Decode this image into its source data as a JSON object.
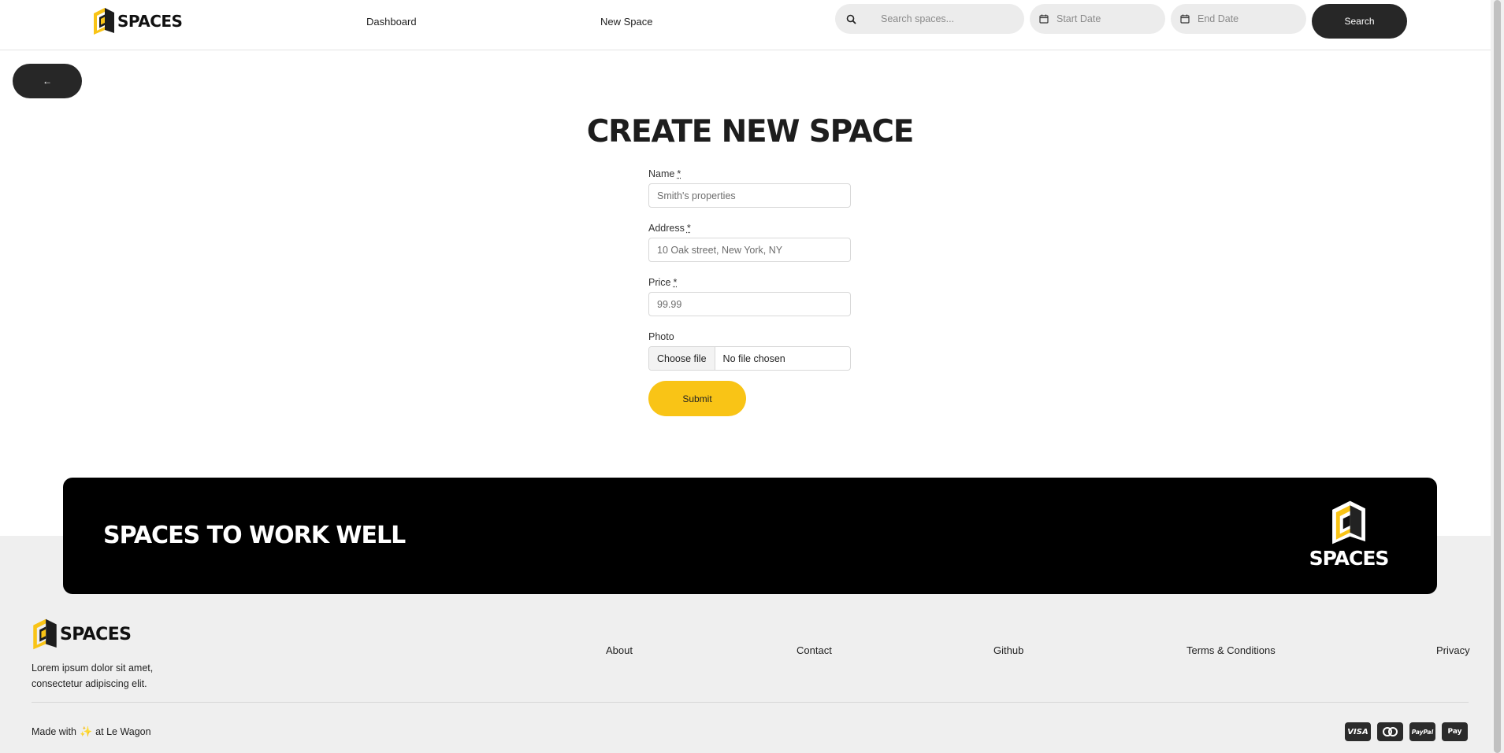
{
  "nav": {
    "brand": "SPACES",
    "links": {
      "dashboard": "Dashboard",
      "new_space": "New Space"
    },
    "search": {
      "placeholder": "Search spaces...",
      "start_date": "Start Date",
      "end_date": "End Date",
      "button": "Search"
    }
  },
  "back_button": "←",
  "page": {
    "title": "CREATE NEW SPACE"
  },
  "form": {
    "name": {
      "label": "Name",
      "required_mark": "*",
      "placeholder": "Smith's properties"
    },
    "address": {
      "label": "Address",
      "required_mark": "*",
      "placeholder": "10 Oak street, New York, NY"
    },
    "price": {
      "label": "Price",
      "required_mark": "*",
      "placeholder": "99.99"
    },
    "photo": {
      "label": "Photo",
      "choose": "Choose file",
      "status": "No file chosen"
    },
    "submit": "Submit"
  },
  "banner": {
    "title": "SPACES TO WORK WELL",
    "logo_text": "SPACES"
  },
  "footer": {
    "brand": "SPACES",
    "description": "Lorem ipsum dolor sit amet, consectetur adipiscing elit.",
    "links": {
      "about": "About",
      "contact": "Contact",
      "github": "Github",
      "terms": "Terms & Conditions",
      "privacy": "Privacy"
    },
    "made_prefix": "Made with",
    "made_icon": "✨",
    "made_suffix": "at Le Wagon",
    "payments": {
      "visa": "VISA",
      "paypal": "PayPal",
      "applepay": " Pay"
    }
  },
  "colors": {
    "accent": "#f9c416",
    "dark": "#272727",
    "banner": "#000000",
    "footer_bg": "#efefef"
  }
}
